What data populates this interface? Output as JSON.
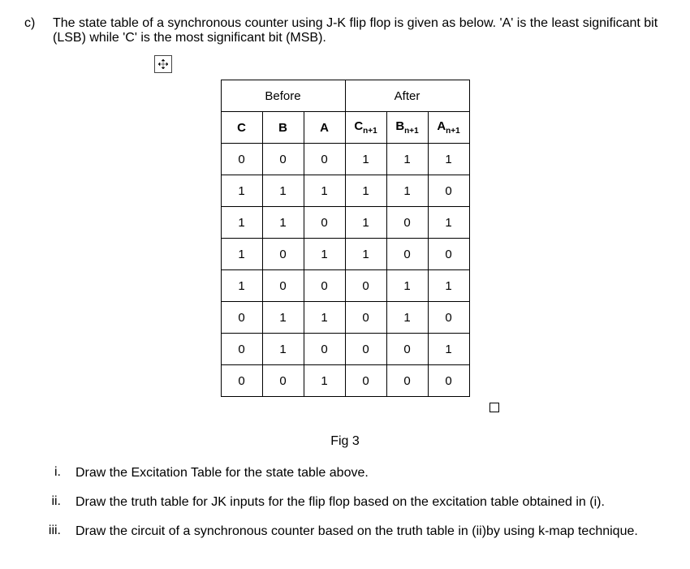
{
  "question": {
    "marker": "c)",
    "text": "The state table of a synchronous counter using J-K flip flop is given as below. 'A' is the least significant bit (LSB) while 'C' is the most significant bit (MSB)."
  },
  "table": {
    "group_before": "Before",
    "group_after": "After",
    "col_C": "C",
    "col_B": "B",
    "col_A": "A",
    "col_Cn1_prefix": "C",
    "col_Bn1_prefix": "B",
    "col_An1_prefix": "A",
    "sub_label": "n+1",
    "rows": [
      {
        "c": "0",
        "b": "0",
        "a": "0",
        "cn": "1",
        "bn": "1",
        "an": "1"
      },
      {
        "c": "1",
        "b": "1",
        "a": "1",
        "cn": "1",
        "bn": "1",
        "an": "0"
      },
      {
        "c": "1",
        "b": "1",
        "a": "0",
        "cn": "1",
        "bn": "0",
        "an": "1"
      },
      {
        "c": "1",
        "b": "0",
        "a": "1",
        "cn": "1",
        "bn": "0",
        "an": "0"
      },
      {
        "c": "1",
        "b": "0",
        "a": "0",
        "cn": "0",
        "bn": "1",
        "an": "1"
      },
      {
        "c": "0",
        "b": "1",
        "a": "1",
        "cn": "0",
        "bn": "1",
        "an": "0"
      },
      {
        "c": "0",
        "b": "1",
        "a": "0",
        "cn": "0",
        "bn": "0",
        "an": "1"
      },
      {
        "c": "0",
        "b": "0",
        "a": "1",
        "cn": "0",
        "bn": "0",
        "an": "0"
      }
    ]
  },
  "figure_label": "Fig 3",
  "items": {
    "i_marker": "i.",
    "i_text": "Draw the Excitation Table for the state table above.",
    "ii_marker": "ii.",
    "ii_text": "Draw the truth table for JK inputs for the flip flop based on the excitation table obtained in (i).",
    "iii_marker": "iii.",
    "iii_text": "Draw the circuit of a synchronous counter based on the truth table in (ii)by using k-map technique."
  }
}
